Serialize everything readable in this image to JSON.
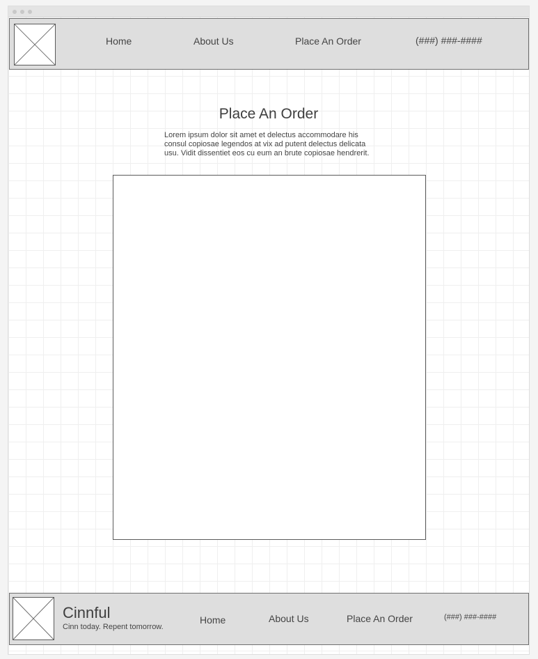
{
  "header": {
    "logo_icon": "image-placeholder-icon",
    "nav": [
      "Home",
      "About Us",
      "Place An Order"
    ],
    "phone": "(###) ###-####"
  },
  "main": {
    "title": "Place An Order",
    "intro": "Lorem ipsum dolor sit amet et delectus accommodare his consul copiosae legendos at vix ad putent delectus delicata usu. Vidit dissentiet eos cu eum an brute copiosae hendrerit."
  },
  "footer": {
    "logo_icon": "image-placeholder-icon",
    "brand": "Cinnful",
    "tagline": "Cinn today. Repent tomorrow.",
    "nav": [
      "Home",
      "About Us",
      "Place An Order"
    ],
    "phone": "(###) ###-####"
  },
  "colors": {
    "bar_background": "#dedede",
    "page_background": "#ffffff",
    "grid_line": "#efefef",
    "border": "#5a5a5a",
    "text": "#444444"
  }
}
